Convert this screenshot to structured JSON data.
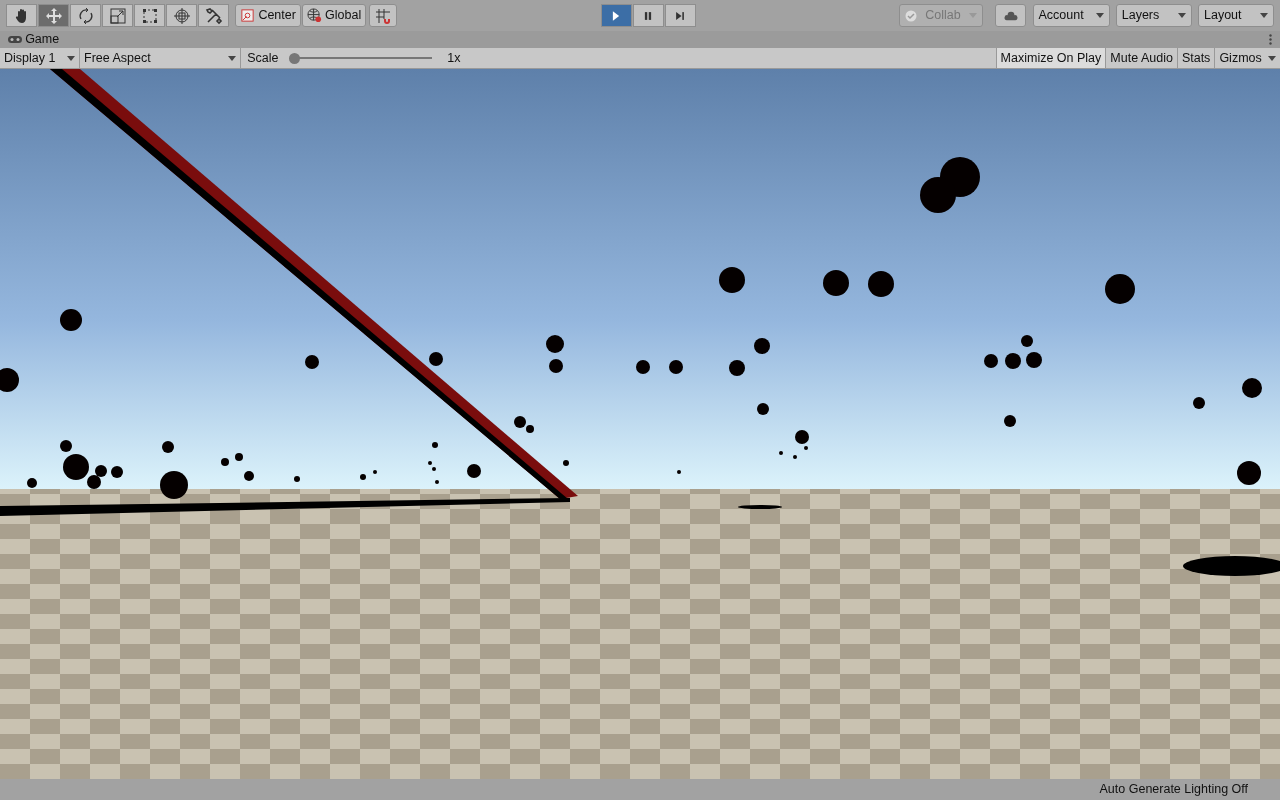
{
  "toolbar": {
    "tools": [
      {
        "kind": "hand",
        "selected": false
      },
      {
        "kind": "move",
        "selected": true
      },
      {
        "kind": "rotate",
        "selected": false
      },
      {
        "kind": "scale",
        "selected": false
      },
      {
        "kind": "rect",
        "selected": false
      },
      {
        "kind": "transform",
        "selected": false
      },
      {
        "kind": "custom",
        "selected": false
      }
    ],
    "pivot_buttons": [
      {
        "kind": "pivot",
        "label": "Center"
      },
      {
        "kind": "global",
        "label": "Global"
      }
    ],
    "play_controls": [
      {
        "kind": "play",
        "on": true
      },
      {
        "kind": "pause",
        "on": false
      },
      {
        "kind": "step",
        "on": false
      }
    ],
    "collab": {
      "label": "Collab",
      "disabled": true
    },
    "dropdowns": [
      "Account",
      "Layers",
      "Layout"
    ]
  },
  "game_tab": {
    "title": "Game"
  },
  "game_toolbar": {
    "display": "Display 1",
    "aspect": "Free Aspect",
    "scale": {
      "label": "Scale",
      "level": 0,
      "reading": "1x"
    },
    "toggles": [
      {
        "label": "Maximize On Play",
        "selected": true
      },
      {
        "label": "Mute Audio",
        "selected": false
      },
      {
        "label": "Stats",
        "selected": false
      }
    ],
    "gizmos": "Gizmos"
  },
  "status_bar": {
    "text": "Auto Generate Lighting Off"
  }
}
